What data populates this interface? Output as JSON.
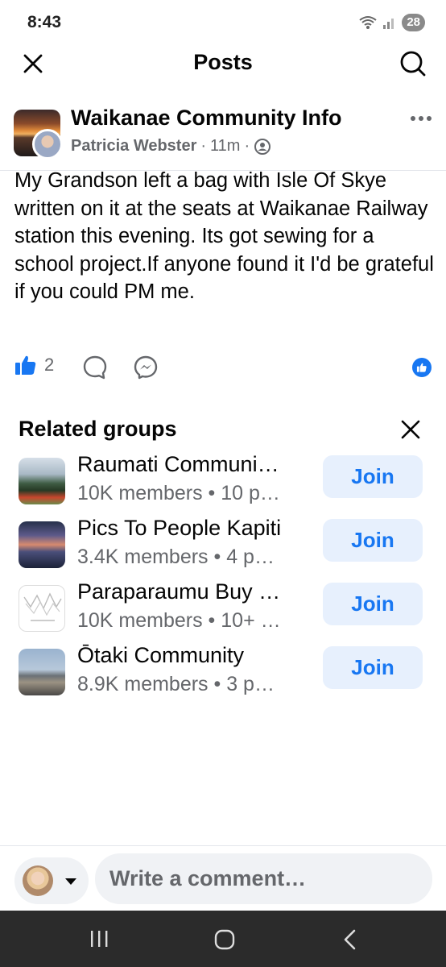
{
  "status_bar": {
    "time": "8:43",
    "battery": "28"
  },
  "header": {
    "title": "Posts"
  },
  "post": {
    "group_name": "Waikanae Community Info",
    "author": "Patricia Webster",
    "time": "11m",
    "body": "My Grandson left a bag with Isle Of Skye written on it at the seats at Waikanae Railway station this evening. Its got sewing for a school project.If anyone found it I'd be grateful if you could PM me.",
    "like_count": "2",
    "reaction_color": "#1877f2"
  },
  "related_groups": {
    "title": "Related groups",
    "groups": [
      {
        "name": "Raumati Communi…",
        "meta": "10K members • 10 p…",
        "join_label": "Join"
      },
      {
        "name": "Pics To People Kapiti",
        "meta": "3.4K members • 4 p…",
        "join_label": "Join"
      },
      {
        "name": "Paraparaumu Buy …",
        "meta": "10K members • 10+ …",
        "join_label": "Join"
      },
      {
        "name": "Ōtaki Community",
        "meta": "8.9K members • 3 p…",
        "join_label": "Join"
      }
    ]
  },
  "comment_bar": {
    "placeholder": "Write a comment…"
  },
  "icons": {
    "close": "close-icon",
    "search": "search-icon",
    "more": "more-horizontal-icon",
    "like": "thumbs-up-icon",
    "comment": "comment-bubble-icon",
    "messenger": "messenger-icon",
    "privacy": "friends-privacy-icon"
  }
}
